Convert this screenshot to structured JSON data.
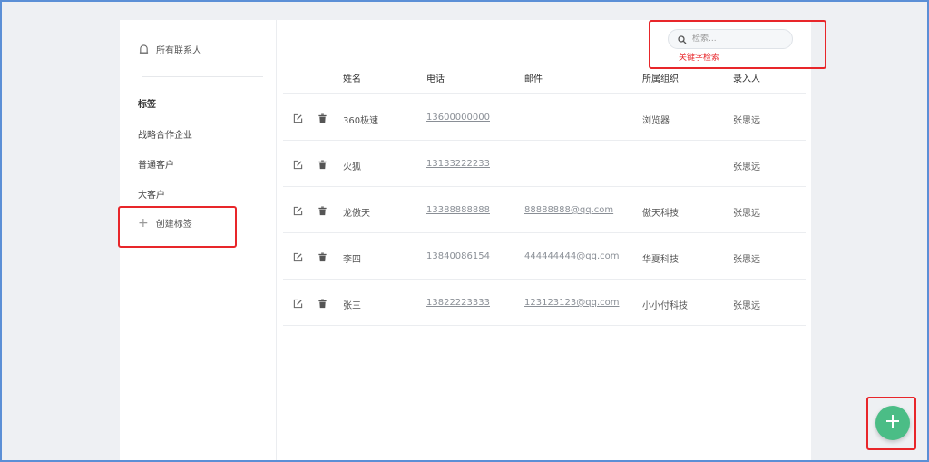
{
  "sidebar": {
    "all_contacts": "所有联系人",
    "tags_heading": "标签",
    "tags": [
      "战略合作企业",
      "普通客户",
      "大客户"
    ],
    "create_tag": "创建标签"
  },
  "search": {
    "placeholder": "检索...",
    "annotation": "关键字检索"
  },
  "table": {
    "columns": [
      "姓名",
      "电话",
      "邮件",
      "所属组织",
      "录入人"
    ],
    "rows": [
      {
        "name": "360极速",
        "phone": "13600000000",
        "email": "",
        "org": "浏览器",
        "creator": "张思远"
      },
      {
        "name": "火狐",
        "phone": "13133222233",
        "email": "",
        "org": "",
        "creator": "张思远"
      },
      {
        "name": "龙傲天",
        "phone": "13388888888",
        "email": "88888888@qq.com",
        "org": "傲天科技",
        "creator": "张思远"
      },
      {
        "name": "李四",
        "phone": "13840086154",
        "email": "444444444@qq.com",
        "org": "华夏科技",
        "creator": "张思远"
      },
      {
        "name": "张三",
        "phone": "13822223333",
        "email": "123123123@qq.com",
        "org": "小小付科技",
        "creator": "张思远"
      }
    ]
  },
  "colors": {
    "accent": "#4bbd86",
    "highlight": "#e8262a",
    "link": "#8a8f96"
  }
}
